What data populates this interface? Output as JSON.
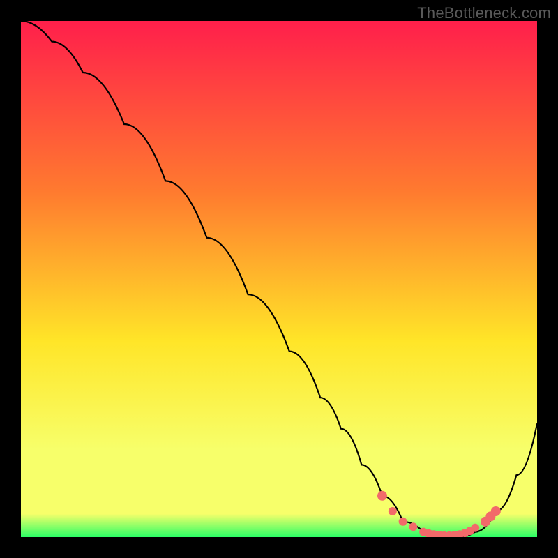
{
  "watermark": "TheBottleneck.com",
  "colors": {
    "bg": "#000000",
    "curve": "#000000",
    "dot_fill": "#f26a6a",
    "dot_stroke": "#f26a6a",
    "grad_top": "#ff1f4b",
    "grad_mid1": "#ff7a2f",
    "grad_mid2": "#ffe528",
    "grad_low": "#f7ff6a",
    "grad_bottom": "#2bff66"
  },
  "chart_data": {
    "type": "line",
    "title": "",
    "xlabel": "",
    "ylabel": "",
    "xlim": [
      0,
      100
    ],
    "ylim": [
      0,
      100
    ],
    "series": [
      {
        "name": "bottleneck-curve",
        "x": [
          0,
          6,
          12,
          20,
          28,
          36,
          44,
          52,
          58,
          62,
          66,
          70,
          74,
          78,
          82,
          85,
          88,
          92,
          96,
          100
        ],
        "y": [
          100,
          96,
          90,
          80,
          69,
          58,
          47,
          36,
          27,
          21,
          14,
          8,
          3,
          1,
          0,
          0,
          1,
          5,
          12,
          22
        ]
      }
    ],
    "dots": {
      "name": "highlight-dots",
      "x": [
        70,
        72,
        74,
        76,
        78,
        79,
        80,
        81,
        82,
        83,
        84,
        85,
        86,
        87,
        88,
        90,
        91,
        92
      ],
      "y": [
        8,
        5,
        3,
        2,
        1,
        0.7,
        0.5,
        0.4,
        0.3,
        0.3,
        0.4,
        0.5,
        0.8,
        1.2,
        1.8,
        3,
        4,
        5
      ]
    }
  }
}
